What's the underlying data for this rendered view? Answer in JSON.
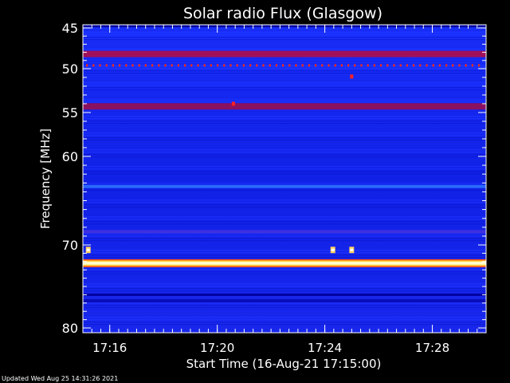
{
  "chart_data": {
    "type": "heatmap",
    "title": "Solar radio Flux (Glasgow)",
    "xlabel": "Start Time (16-Aug-21 17:15:00)",
    "ylabel": "Frequency [MHz]",
    "x_unit": "minutes after 17:15:00",
    "xlim": [
      0,
      15
    ],
    "ylim": [
      80,
      44.5
    ],
    "x_ticks": [
      {
        "value": 1,
        "label": "17:16"
      },
      {
        "value": 5,
        "label": "17:20"
      },
      {
        "value": 9,
        "label": "17:24"
      },
      {
        "value": 13,
        "label": "17:28"
      }
    ],
    "y_ticks": [
      45,
      50,
      55,
      60,
      70,
      80
    ],
    "emission_bands": [
      {
        "freq": 48.2,
        "intensity": "high",
        "color": "#a0105a"
      },
      {
        "freq": 49.6,
        "intensity": "medium",
        "color": "#ff2a10"
      },
      {
        "freq": 54.3,
        "intensity": "high",
        "color": "#8a1060"
      },
      {
        "freq": 63.4,
        "intensity": "medium",
        "color": "#2a6aff"
      },
      {
        "freq": 68.5,
        "intensity": "medium",
        "color": "#4030e0"
      },
      {
        "freq": 72.2,
        "intensity": "saturated",
        "color": "#ffff90"
      },
      {
        "freq": 76.0,
        "intensity": "low",
        "color": "#0000a0"
      }
    ],
    "bursts": [
      {
        "time": 0.2,
        "freq": 70.6,
        "color": "#ffd060"
      },
      {
        "time": 9.3,
        "freq": 70.6,
        "color": "#ffd060"
      },
      {
        "time": 10.0,
        "freq": 70.6,
        "color": "#ffd060"
      },
      {
        "time": 10.0,
        "freq": 50.9,
        "color": "#ff2020"
      },
      {
        "time": 5.6,
        "freq": 54.0,
        "color": "#ff2020"
      }
    ],
    "footer": "Updated Wed Aug 25 14:31:26 2021"
  }
}
